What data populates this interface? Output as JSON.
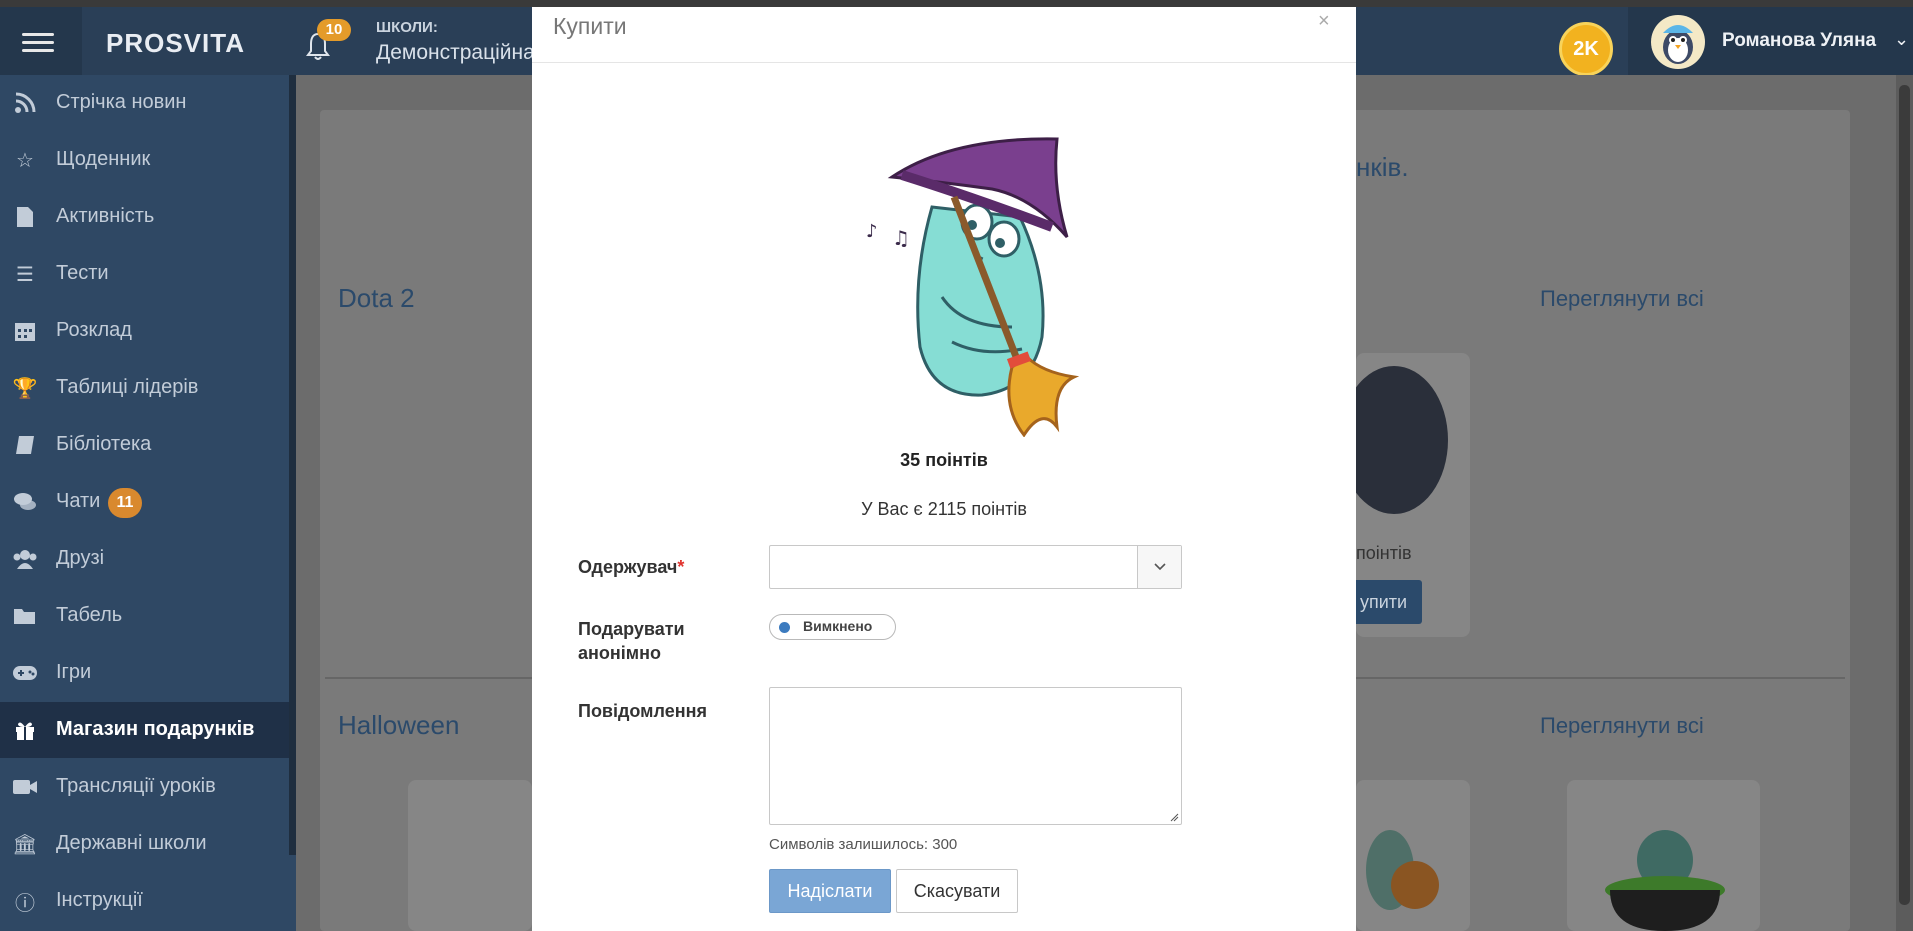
{
  "header": {
    "logo": "PROSVITA",
    "notifications_count": "10",
    "school_label": "ШКОЛИ:",
    "school_name": "Демонстраційна",
    "coins": "2K",
    "user_name": "Романова Уляна"
  },
  "sidebar": {
    "items": [
      {
        "label": "Стрічка новин",
        "icon": "rss-icon"
      },
      {
        "label": "Щоденник",
        "icon": "star-icon"
      },
      {
        "label": "Активність",
        "icon": "file-icon"
      },
      {
        "label": "Тести",
        "icon": "list-icon"
      },
      {
        "label": "Розклад",
        "icon": "calendar-icon"
      },
      {
        "label": "Таблиці лідерів",
        "icon": "trophy-icon"
      },
      {
        "label": "Бібліотека",
        "icon": "book-icon"
      },
      {
        "label": "Чати",
        "icon": "chat-icon",
        "badge": "11"
      },
      {
        "label": "Друзі",
        "icon": "users-icon"
      },
      {
        "label": "Табель",
        "icon": "folder-icon"
      },
      {
        "label": "Ігри",
        "icon": "gamepad-icon"
      },
      {
        "label": "Магазин подарунків",
        "icon": "gift-icon",
        "active": true
      },
      {
        "label": "Трансляції уроків",
        "icon": "video-icon"
      },
      {
        "label": "Державні школи",
        "icon": "bank-icon"
      },
      {
        "label": "Інструкції",
        "icon": "info-icon"
      }
    ]
  },
  "background": {
    "partial_text": "нків.",
    "section1_title": "Dota 2",
    "section2_title": "Halloween",
    "view_all": "Переглянути всі",
    "card_points": "поінтів",
    "card_buy": "упити"
  },
  "modal": {
    "title": "Купити",
    "close": "×",
    "price": "35 поінтів",
    "balance": "У Вас є 2115 поінтів",
    "recipient_label": "Одержувач",
    "required_mark": "*",
    "anonymous_label_line1": "Подарувати",
    "anonymous_label_line2": "анонімно",
    "toggle_text": "Вимкнено",
    "message_label": "Повідомлення",
    "chars_left": "Символів залишилось: 300",
    "send_button": "Надіслати",
    "cancel_button": "Скасувати"
  },
  "colors": {
    "header": "#2a3f57",
    "sidebar": "#2f4864",
    "accent": "#7aa6d5",
    "badge": "#e49b2a"
  }
}
